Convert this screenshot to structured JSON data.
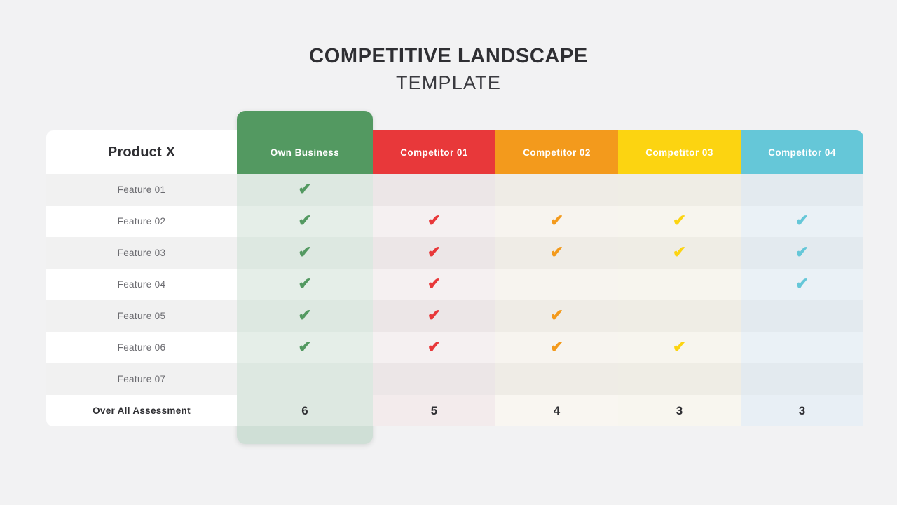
{
  "title": {
    "main": "COMPETITIVE LANDSCAPE",
    "sub": "TEMPLATE"
  },
  "colors": {
    "background": "#f2f2f3",
    "own_business": "#539961",
    "competitor_01": "#e8383a",
    "competitor_02": "#f39a1c",
    "competitor_03": "#fcd411",
    "competitor_04": "#65c7d8"
  },
  "table": {
    "corner_header": "Product X",
    "footer_label": "Over All Assessment",
    "check_glyph": "✔",
    "columns": [
      {
        "key": "own",
        "label": "Own Business",
        "color": "#539961",
        "highlighted": true
      },
      {
        "key": "c1",
        "label": "Competitor 01",
        "color": "#e8383a",
        "highlighted": false
      },
      {
        "key": "c2",
        "label": "Competitor 02",
        "color": "#f39a1c",
        "highlighted": false
      },
      {
        "key": "c3",
        "label": "Competitor 03",
        "color": "#fcd411",
        "highlighted": false
      },
      {
        "key": "c4",
        "label": "Competitor 04",
        "color": "#65c7d8",
        "highlighted": false
      }
    ],
    "rows": [
      {
        "label": "Feature 01",
        "own": true,
        "c1": false,
        "c2": false,
        "c3": false,
        "c4": false
      },
      {
        "label": "Feature 02",
        "own": true,
        "c1": true,
        "c2": true,
        "c3": true,
        "c4": true
      },
      {
        "label": "Feature 03",
        "own": true,
        "c1": true,
        "c2": true,
        "c3": true,
        "c4": true
      },
      {
        "label": "Feature 04",
        "own": true,
        "c1": true,
        "c2": false,
        "c3": false,
        "c4": true
      },
      {
        "label": "Feature 05",
        "own": true,
        "c1": true,
        "c2": true,
        "c3": false,
        "c4": false
      },
      {
        "label": "Feature 06",
        "own": true,
        "c1": true,
        "c2": true,
        "c3": true,
        "c4": false
      },
      {
        "label": "Feature 07",
        "own": false,
        "c1": false,
        "c2": false,
        "c3": false,
        "c4": false
      }
    ],
    "scores": {
      "own": "6",
      "c1": "5",
      "c2": "4",
      "c3": "3",
      "c4": "3"
    }
  }
}
